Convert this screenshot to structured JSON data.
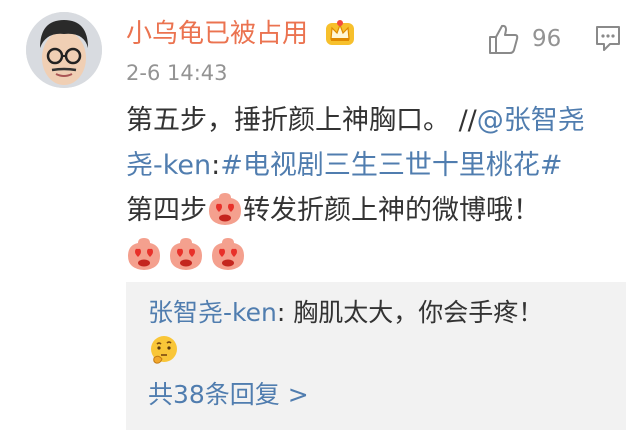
{
  "post": {
    "username": "小乌龟已被占用",
    "timestamp": "2-6 14:43",
    "like_count": "96",
    "content": {
      "line1": "第五步，捶折颜上神胸口。 //",
      "mention": "@张智尧-ken",
      "colon": ":",
      "hashtag": "#电视剧三生三世十里桃花#",
      "line3a": "第四步",
      "line3b": "转发折颜上神的微博哦！"
    },
    "icons": {
      "crown": "crown-badge-icon",
      "like": "thumb-up-icon",
      "comment": "comment-icon",
      "heart_eyes": "heart-eyes-emoji",
      "thinking": "thinking-emoji"
    }
  },
  "reply": {
    "user": "张智尧-ken",
    "separator": ": ",
    "text": "胸肌太大，你会手疼！",
    "more_label": "共38条回复 >"
  },
  "colors": {
    "username": "#eb7350",
    "link": "#507daf",
    "meta": "#939393",
    "reply_bg": "#f2f2f2"
  }
}
